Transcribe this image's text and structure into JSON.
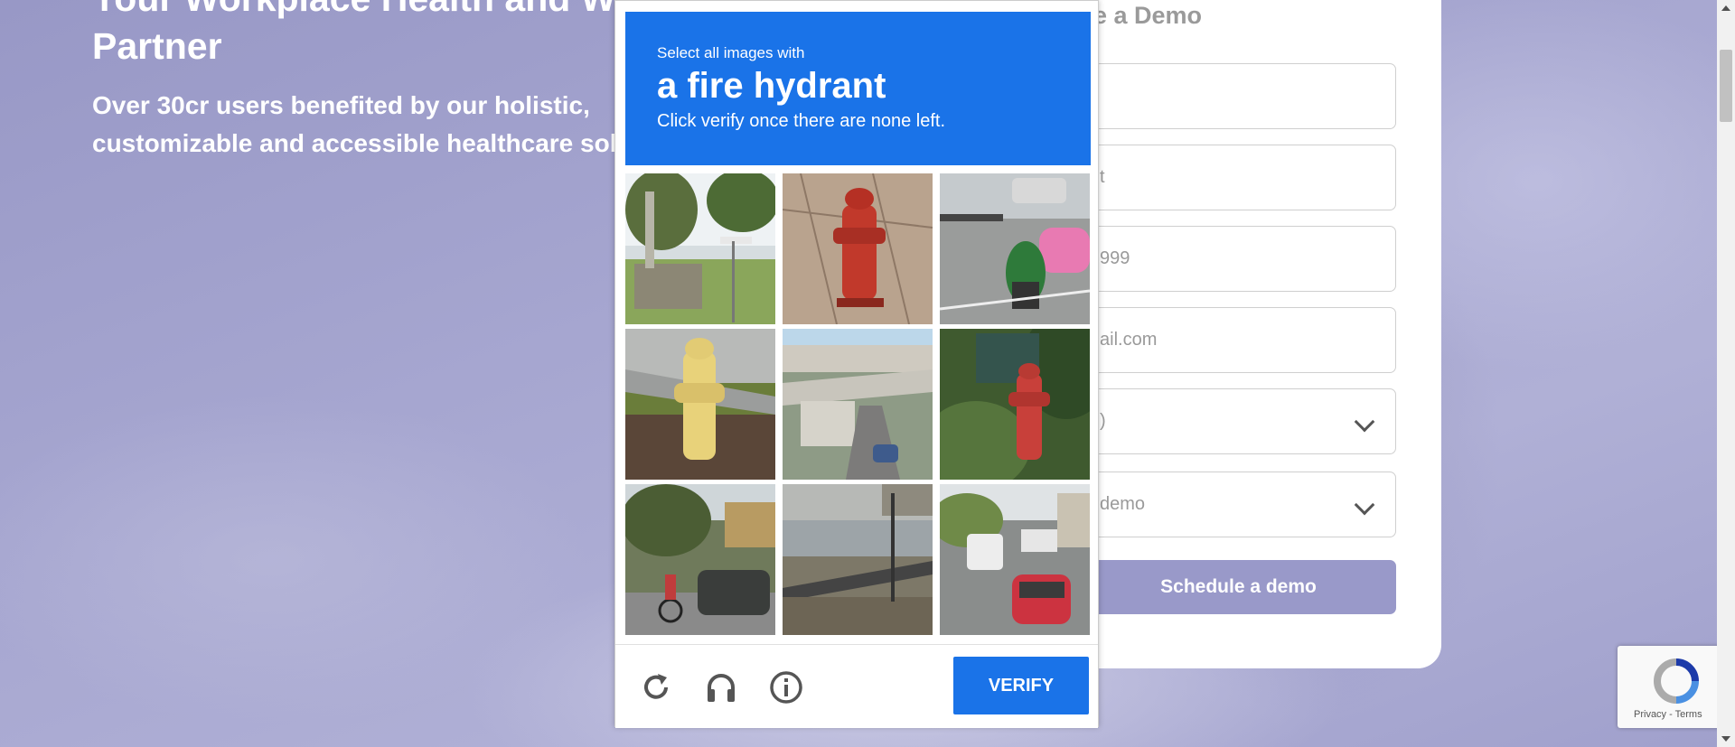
{
  "hero": {
    "title": "Your Workplace Health and We... Partner",
    "title_line1": "Your Workplace Health and We",
    "title_line2": "Partner",
    "subtitle_line1": "Over 30cr users benefited by our holistic,",
    "subtitle_line2": "customizable and accessible healthcare solu"
  },
  "form": {
    "title": "e a Demo",
    "fields": [
      {
        "value": ""
      },
      {
        "value": "t"
      },
      {
        "value": "999"
      },
      {
        "value": "ail.com"
      },
      {
        "value": ")"
      },
      {
        "value": "demo"
      }
    ],
    "schedule_label": "Schedule a demo"
  },
  "captcha": {
    "instruction_small": "Select all images with",
    "target": "a fire hydrant",
    "note": "Click verify once there are none left.",
    "verify_label": "VERIFY",
    "tiles": [
      {
        "content": "monument and trees"
      },
      {
        "content": "red fire hydrant"
      },
      {
        "content": "street with motorcycle"
      },
      {
        "content": "yellow fire hydrant"
      },
      {
        "content": "road under bridge"
      },
      {
        "content": "red fire hydrant in bushes"
      },
      {
        "content": "street with cyclist and car"
      },
      {
        "content": "rocky shore with guardrail"
      },
      {
        "content": "street with red car"
      }
    ]
  },
  "recaptcha_badge": {
    "terms": "Privacy - Terms"
  },
  "colors": {
    "captcha_blue": "#1a73e8",
    "schedule_purple": "#9999c9",
    "page_bg": "#a3a3cc"
  }
}
